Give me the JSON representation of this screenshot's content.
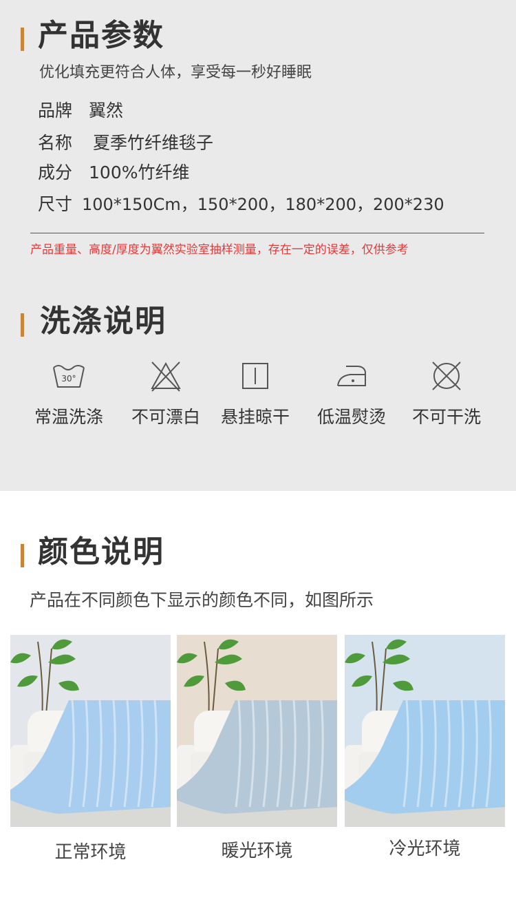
{
  "params": {
    "title": "产品参数",
    "subtitle": "优化填充更符合人体，享受每一秒好睡眠",
    "rows": [
      {
        "label": "品牌",
        "value": "翼然"
      },
      {
        "label": "名称",
        "value": "夏季竹纤维毯子"
      },
      {
        "label": "成分",
        "value": "100%竹纤维"
      },
      {
        "label": "尺寸",
        "value": "100*150Cm，150*200，180*200，200*230"
      }
    ],
    "disclaimer": "产品重量、高度/厚度为翼然实验室抽样测量，存在一定的误差，仅供参考"
  },
  "washing": {
    "title": "洗涤说明",
    "items": [
      {
        "icon": "wash-30-icon",
        "label": "常温洗涤",
        "temp": "30°"
      },
      {
        "icon": "no-bleach-icon",
        "label": "不可漂白"
      },
      {
        "icon": "hang-dry-icon",
        "label": "悬挂晾干"
      },
      {
        "icon": "iron-low-icon",
        "label": "低温熨烫"
      },
      {
        "icon": "no-dry-clean-icon",
        "label": "不可干洗"
      }
    ]
  },
  "colors": {
    "title": "颜色说明",
    "subtitle": "产品在不同颜色下显示的颜色不同，如图所示",
    "photos": [
      {
        "caption": "正常环境",
        "bg": "#e3e6ea",
        "blanket": "#a9cdef"
      },
      {
        "caption": "暖光环境",
        "bg": "#e7ddd0",
        "blanket": "#b5c8d8"
      },
      {
        "caption": "冷光环境",
        "bg": "#d5e3ee",
        "blanket": "#a3cdef"
      }
    ]
  },
  "theme": {
    "accent": "#c9853a",
    "panel": "#eaeaea",
    "warning": "#e23a3a"
  }
}
